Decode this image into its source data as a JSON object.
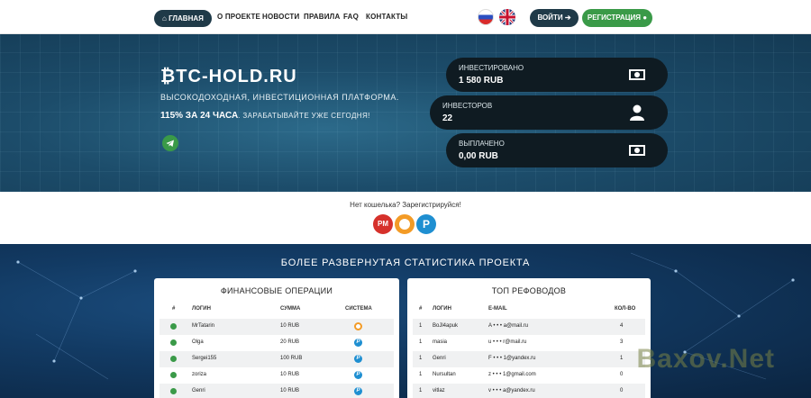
{
  "nav": {
    "home": "ГЛАВНАЯ",
    "links": [
      "О ПРОЕКТЕ",
      "НОВОСТИ",
      "ПРАВИЛА",
      "FAQ",
      "КОНТАКТЫ"
    ],
    "login": "ВОЙТИ",
    "register": "РЕГИСТРАЦИЯ"
  },
  "hero": {
    "title": "₿TC-HOLD.RU",
    "subtitle": "ВЫСОКОДОХОДНАЯ, ИНВЕСТИЦИОННАЯ ПЛАТФОРМА.",
    "rate_bold": "115% ЗА 24 ЧАСА",
    "rate_rest": ". ЗАРАБАТЫВАЙТЕ УЖЕ СЕГОДНЯ!"
  },
  "cards": [
    {
      "label": "ИНВЕСТИРОВАНО",
      "value": "1 580 RUB",
      "icon": "money-icon"
    },
    {
      "label": "ИНВЕСТОРОВ",
      "value": "22",
      "icon": "user-icon"
    },
    {
      "label": "ВЫПЛАЧЕНО",
      "value": "0,00 RUB",
      "icon": "money-icon"
    }
  ],
  "wallets": {
    "text": "Нет кошелька? Зарегистрируйся!",
    "pm": "PM",
    "payeer": "P"
  },
  "stats": {
    "title": "БОЛЕЕ РАЗВЕРНУТАЯ СТАТИСТИКА ПРОЕКТА",
    "finance": {
      "title": "ФИНАНСОВЫЕ ОПЕРАЦИИ",
      "headers": [
        "#",
        "ЛОГИН",
        "СУММА",
        "СИСТЕМА"
      ],
      "rows": [
        {
          "login": "MrTatarin",
          "amount": "10 RUB",
          "system": "qiwi"
        },
        {
          "login": "Olga",
          "amount": "20 RUB",
          "system": "payeer"
        },
        {
          "login": "Sergei155",
          "amount": "100 RUB",
          "system": "payeer"
        },
        {
          "login": "zoriza",
          "amount": "10 RUB",
          "system": "payeer"
        },
        {
          "login": "Genri",
          "amount": "10 RUB",
          "system": "payeer"
        }
      ]
    },
    "referrals": {
      "title": "ТОП РЕФОВОДОВ",
      "headers": [
        "#",
        "ЛОГИН",
        "E-MAIL",
        "КОЛ-ВО"
      ],
      "rows": [
        {
          "num": "1",
          "login": "BoJl4apuk",
          "email": "A • • • a@mail.ru",
          "count": "4"
        },
        {
          "num": "1",
          "login": "masia",
          "email": "u • • • r@mail.ru",
          "count": "3"
        },
        {
          "num": "1",
          "login": "Genri",
          "email": "F • • • 1@yandex.ru",
          "count": "1"
        },
        {
          "num": "1",
          "login": "Nursultan",
          "email": "z • • • 1@gmail.com",
          "count": "0"
        },
        {
          "num": "1",
          "login": "vitlaz",
          "email": "v • • • a@yandex.ru",
          "count": "0"
        }
      ]
    }
  },
  "watermark": "Baxov.Net",
  "colors": {
    "dark": "#1f3a48",
    "green": "#3a9a48",
    "qiwi": "#f39b26",
    "payeer": "#1f8fd1",
    "pm": "#d6312b"
  }
}
